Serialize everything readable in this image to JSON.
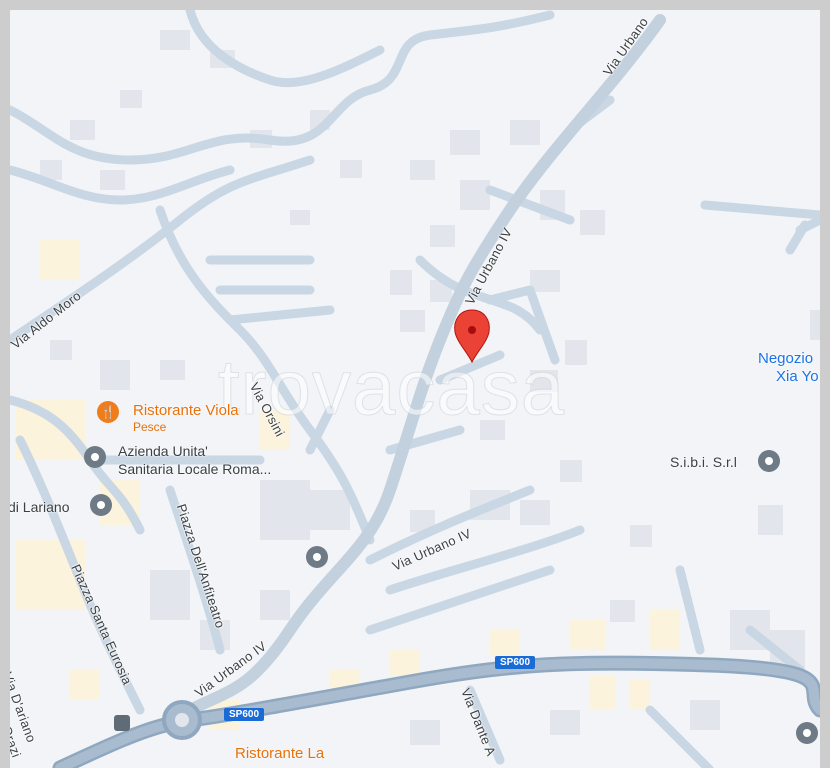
{
  "map": {
    "streets": {
      "via_aldo_moro": "Via Aldo Moro",
      "via_urbano_top": "Via Urbano",
      "via_urbano_iv_mid": "Via Urbano IV",
      "via_urbano_iv_lower": "Via Urbano IV",
      "via_urbano_iv_bottom": "Via Urbano IV",
      "via_orsini": "Via Orsini",
      "piazza_anfiteatro": "Piazza Dell'Anfiteatro",
      "piazza_santa_eurosia": "Piazza Santa Eurosia",
      "via_dante": "Via Dante A",
      "via_d_ariano": "Via D'ariano",
      "via_orazio_fragment": "ia Orazi"
    },
    "road_shields": [
      "SP600",
      "SP600"
    ],
    "places": {
      "restaurant_name": "Ristorante Viola",
      "restaurant_category": "Pesce",
      "asl_line1": "Azienda Unita'",
      "asl_line2": "Sanitaria Locale Roma...",
      "lariano": "di Lariano",
      "sibi": "S.i.b.i. S.r.l",
      "negozio_line1": "Negozio",
      "negozio_line2": "Xia Yo",
      "restaurant_bottom": "Ristorante La"
    },
    "watermark": "trovacasa",
    "colors": {
      "marker": "#ea4335",
      "road": "#c9d6e3",
      "main_road": "#8fa7bf",
      "poi_text_orange": "#e8710a",
      "poi_text_blue": "#1a73e8"
    }
  }
}
